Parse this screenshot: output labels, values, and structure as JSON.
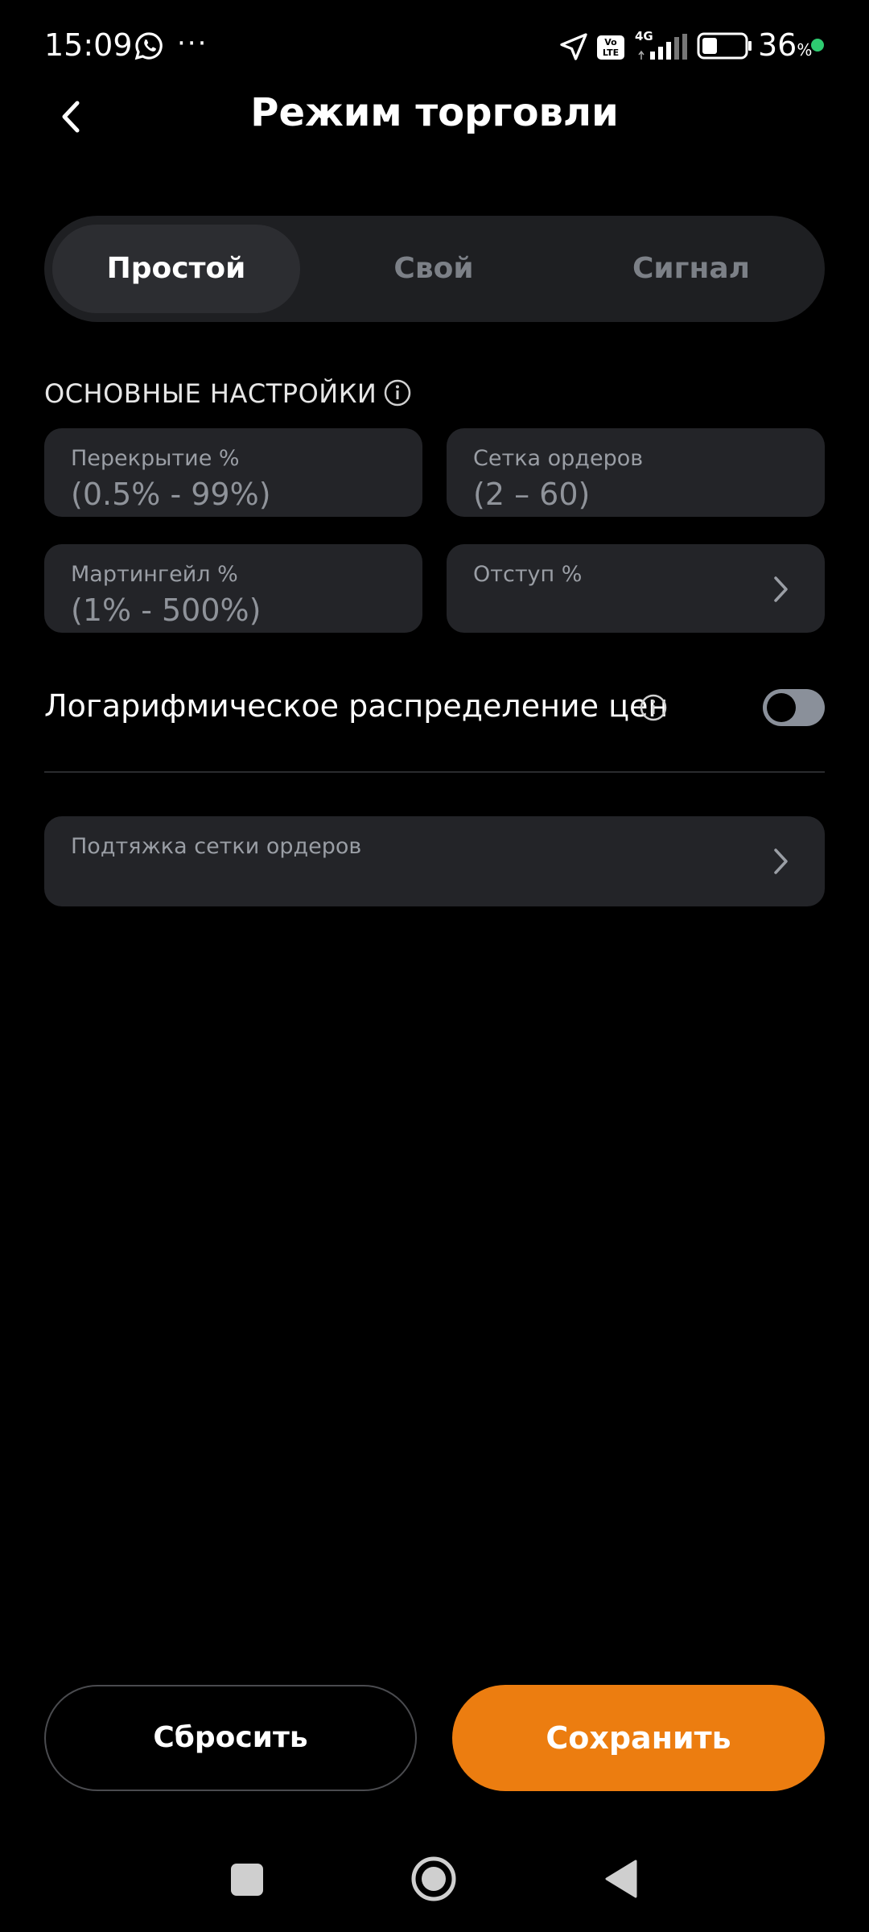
{
  "status_bar": {
    "time": "15:09",
    "more": "···",
    "network": "4G",
    "volte": "Vo\nLTE",
    "battery_percent": "36",
    "battery_percent_sign": "%",
    "battery_level": 0.36,
    "icons": [
      "whatsapp-icon",
      "more-dots-icon",
      "navigation-icon",
      "volte-icon",
      "signal-icon",
      "battery-icon",
      "active-dot"
    ]
  },
  "header": {
    "title": "Режим торговли",
    "back_icon": "chevron-left-icon"
  },
  "tabs": [
    {
      "label": "Простой",
      "active": true
    },
    {
      "label": "Свой",
      "active": false
    },
    {
      "label": "Сигнал",
      "active": false
    }
  ],
  "section": {
    "title": "ОСНОВНЫЕ НАСТРОЙКИ",
    "info_icon": "info-icon"
  },
  "fields": {
    "overlap": {
      "label": "Перекрытие %",
      "placeholder": "(0.5% - 99%)"
    },
    "order_grid": {
      "label": "Сетка ордеров",
      "placeholder": "(2 – 60)"
    },
    "martingale": {
      "label": "Мартингейл %",
      "placeholder": "(1% - 500%)"
    },
    "indent": {
      "label": "Отступ %"
    },
    "grid_pullup": {
      "label": "Подтяжка сетки ордеров"
    }
  },
  "log_distribution": {
    "label": "Логарифмическое распределение цен",
    "enabled": false
  },
  "buttons": {
    "reset": "Сбросить",
    "save": "Сохранить"
  },
  "colors": {
    "background": "#000000",
    "card": "#232428",
    "accent": "#ec7d10",
    "muted_text": "#9a9ea5"
  }
}
